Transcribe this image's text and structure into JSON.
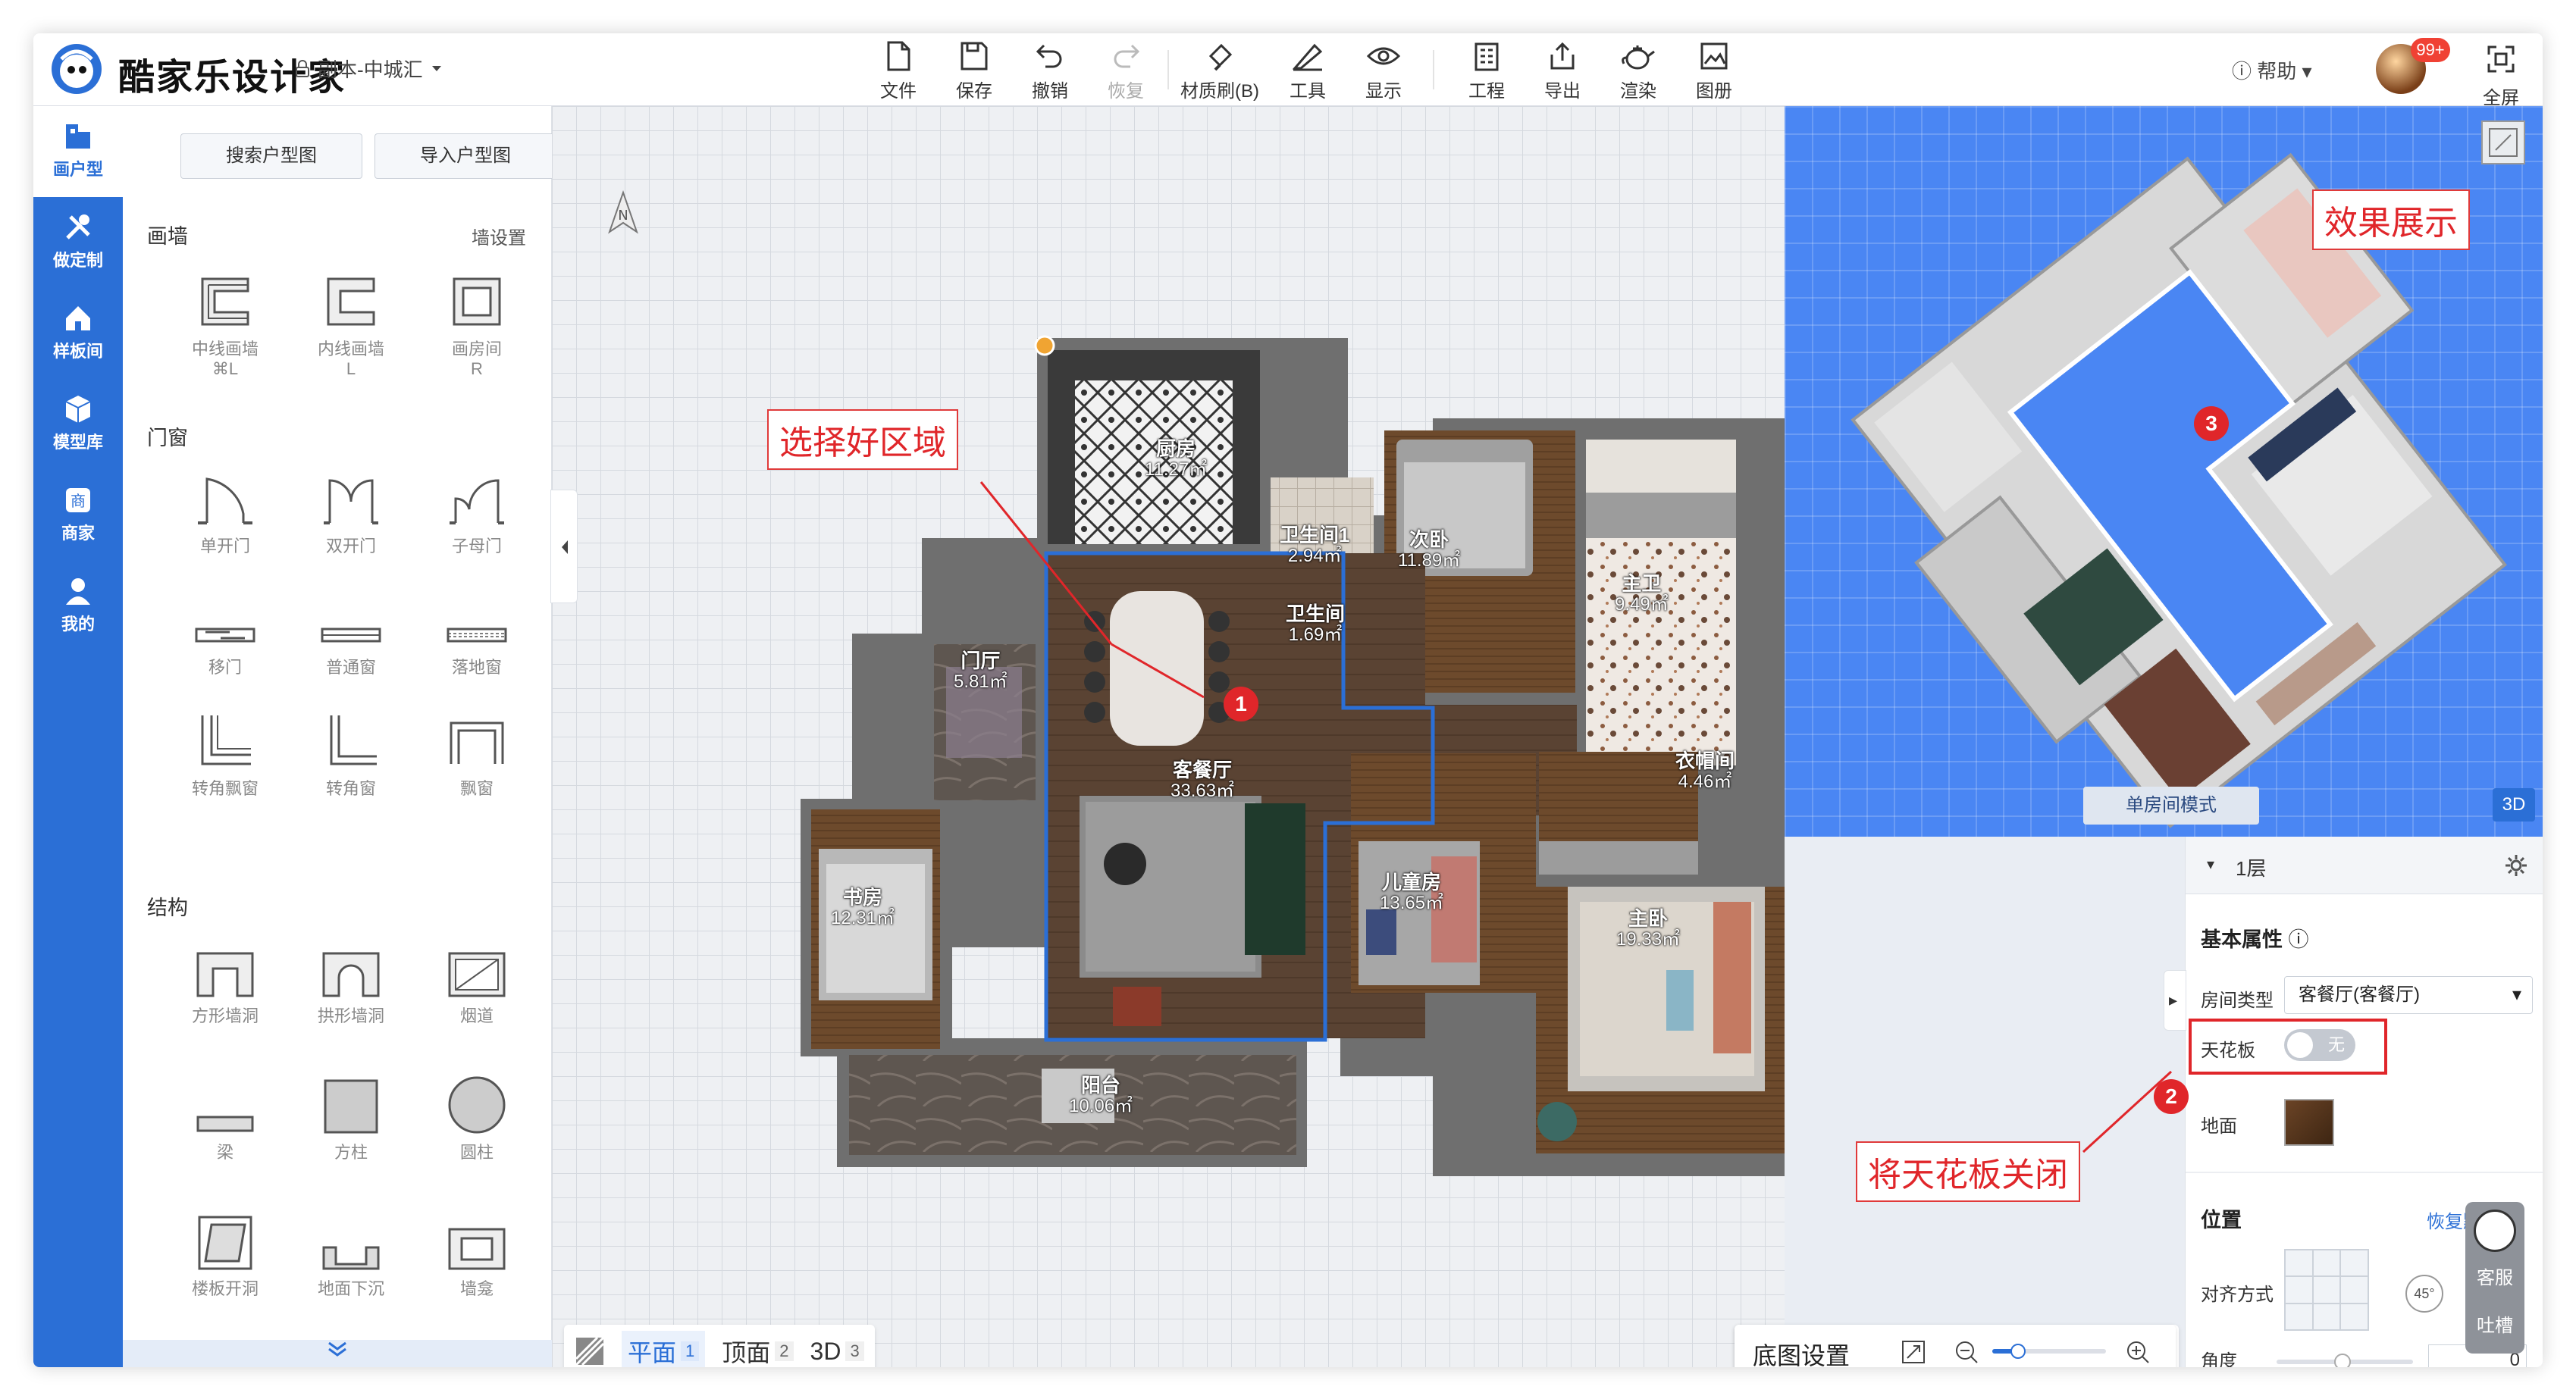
{
  "header": {
    "brand": "酷家乐设计家",
    "doc_title": "副本-中城汇",
    "tools": [
      {
        "label": "文件",
        "icon": "file-icon"
      },
      {
        "label": "保存",
        "icon": "save-icon"
      },
      {
        "label": "撤销",
        "icon": "undo-icon"
      },
      {
        "label": "恢复",
        "icon": "redo-icon"
      },
      {
        "label": "材质刷(B)",
        "icon": "brush-icon"
      },
      {
        "label": "工具",
        "icon": "ruler-icon"
      },
      {
        "label": "显示",
        "icon": "eye-icon"
      },
      {
        "label": "工程",
        "icon": "building-icon"
      },
      {
        "label": "导出",
        "icon": "export-icon"
      },
      {
        "label": "渲染",
        "icon": "teapot-icon"
      },
      {
        "label": "图册",
        "icon": "album-icon"
      }
    ],
    "help": "帮助",
    "badge": "99+",
    "fullscreen": "全屏"
  },
  "nav": [
    {
      "label": "画户型",
      "icon": "floorplan-icon"
    },
    {
      "label": "做定制",
      "icon": "tools-icon"
    },
    {
      "label": "样板间",
      "icon": "house-icon"
    },
    {
      "label": "模型库",
      "icon": "cube-icon"
    },
    {
      "label": "商家",
      "icon": "shop-icon"
    },
    {
      "label": "我的",
      "icon": "user-icon"
    }
  ],
  "panel": {
    "search_btn": "搜索户型图",
    "import_btn": "导入户型图",
    "sections": {
      "wall": "画墙",
      "wall_settings": "墙设置",
      "doorwin": "门窗",
      "struct": "结构"
    },
    "wall_items": [
      {
        "label": "中线画墙",
        "key": "⌘L"
      },
      {
        "label": "内线画墙",
        "key": "L"
      },
      {
        "label": "画房间",
        "key": "R"
      }
    ],
    "door_items": [
      "单开门",
      "双开门",
      "子母门",
      "移门",
      "普通窗",
      "落地窗",
      "转角飘窗",
      "转角窗",
      "飘窗"
    ],
    "struct_items": [
      "方形墙洞",
      "拱形墙洞",
      "烟道",
      "梁",
      "方柱",
      "圆柱",
      "楼板开洞",
      "地面下沉",
      "墙龛"
    ]
  },
  "plan": {
    "rooms": [
      {
        "name": "厨房",
        "area": "11.27㎡"
      },
      {
        "name": "卫生间1",
        "area": "2.94㎡"
      },
      {
        "name": "卫生间",
        "area": "1.69㎡"
      },
      {
        "name": "次卧",
        "area": "11.89㎡"
      },
      {
        "name": "主卫",
        "area": "9.49㎡"
      },
      {
        "name": "门厅",
        "area": "5.81㎡"
      },
      {
        "name": "客餐厅",
        "area": "33.63㎡"
      },
      {
        "name": "衣帽间",
        "area": "4.46㎡"
      },
      {
        "name": "书房",
        "area": "12.31㎡"
      },
      {
        "name": "儿童房",
        "area": "13.65㎡"
      },
      {
        "name": "主卧",
        "area": "19.33㎡"
      },
      {
        "name": "阳台",
        "area": "10.06㎡"
      }
    ],
    "callout_select": "选择好区域",
    "callout_ceiling": "将天花板关闭",
    "callout_effect": "效果展示",
    "north": "N",
    "markers": [
      "1",
      "2",
      "3"
    ]
  },
  "view_tabs": [
    {
      "label": "平面",
      "num": "1"
    },
    {
      "label": "顶面",
      "num": "2"
    },
    {
      "label": "3D",
      "num": "3"
    }
  ],
  "bottom": {
    "base_settings": "底图设置"
  },
  "preview": {
    "single_room": "单房间模式",
    "mode_3d": "3D"
  },
  "props": {
    "floor": "1层",
    "basic": "基本属性",
    "room_type_label": "房间类型",
    "room_type": "客餐厅(客餐厅)",
    "ceiling_label": "天花板",
    "ceiling_state": "无",
    "floor_label": "地面",
    "position": "位置",
    "reset": "恢复默认",
    "align": "对齐方式",
    "angle_label": "角度",
    "angle_value": "0",
    "angle_badge": "45°"
  },
  "support": {
    "line1": "客服",
    "line2": "吐槽"
  }
}
